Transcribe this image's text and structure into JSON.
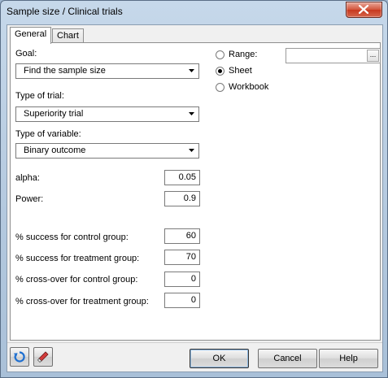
{
  "window": {
    "title": "Sample size / Clinical trials"
  },
  "tabs": [
    {
      "label": "General",
      "active": true
    },
    {
      "label": "Chart",
      "active": false
    }
  ],
  "goal": {
    "label": "Goal:",
    "value": "Find the sample size"
  },
  "trial_type": {
    "label": "Type of trial:",
    "value": "Superiority trial"
  },
  "variable_type": {
    "label": "Type of variable:",
    "value": "Binary outcome"
  },
  "params": {
    "alpha": {
      "label": "alpha:",
      "value": "0.05"
    },
    "power": {
      "label": "Power:",
      "value": "0.9"
    },
    "success_control": {
      "label": "% success for control group:",
      "value": "60"
    },
    "success_treatment": {
      "label": "% success for treatment group:",
      "value": "70"
    },
    "crossover_control": {
      "label": "% cross-over for control group:",
      "value": "0"
    },
    "crossover_treatment": {
      "label": "% cross-over for treatment group:",
      "value": "0"
    }
  },
  "output": {
    "range_label": "Range:",
    "sheet_label": "Sheet",
    "workbook_label": "Workbook",
    "selected": "Sheet",
    "range_value": "",
    "range_button": "..."
  },
  "buttons": {
    "ok": "OK",
    "cancel": "Cancel",
    "help": "Help"
  },
  "colors": {
    "close": "#c7381e",
    "title_bar": "#b3c8de",
    "reset_icon": "#1e6fd0",
    "eraser_icon": "#d33a3a"
  }
}
